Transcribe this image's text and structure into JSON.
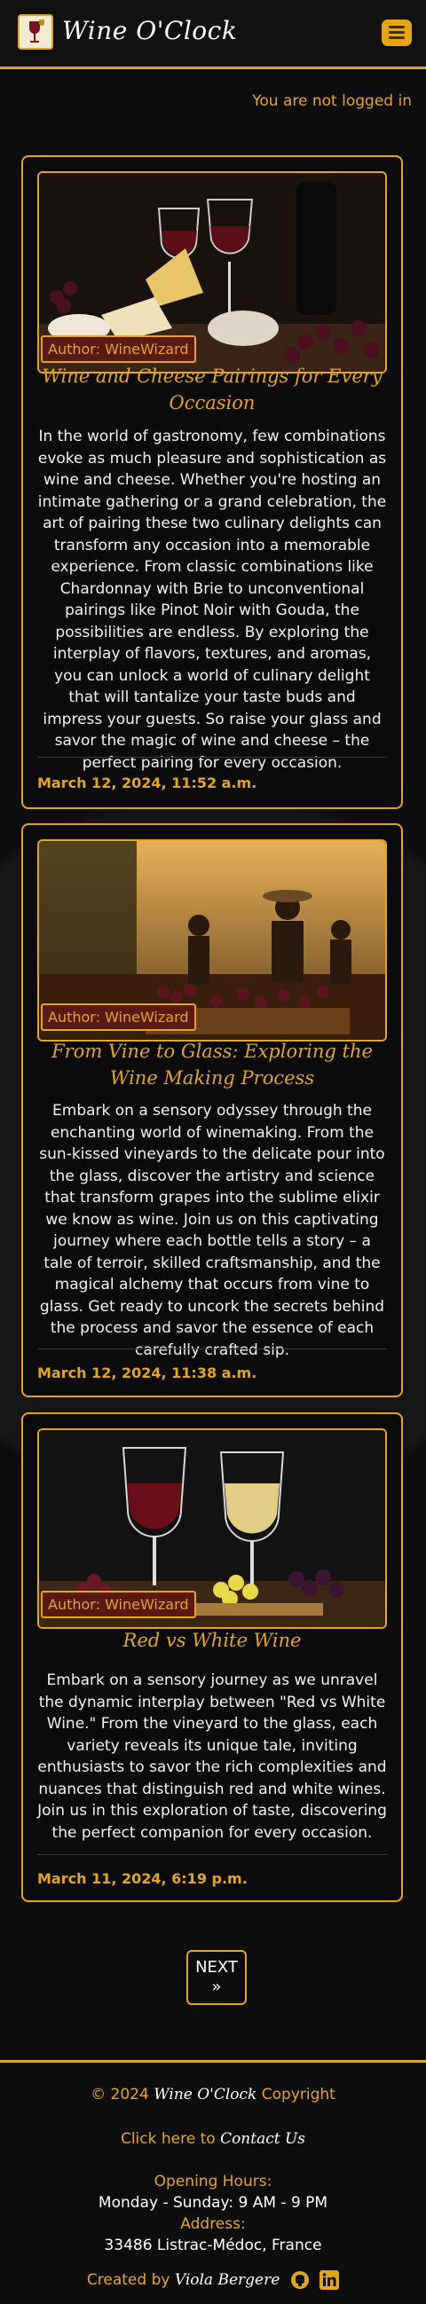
{
  "navbar": {
    "brand": "Wine O'Clock"
  },
  "auth": {
    "status": "You are not logged in"
  },
  "posts": [
    {
      "author": "Author: WineWizard",
      "title": "Wine and Cheese Pairings for Every Occasion",
      "body": "In the world of gastronomy, few combinations evoke as much pleasure and sophistication as wine and cheese. Whether you're hosting an intimate gathering or a grand celebration, the art of pairing these two culinary delights can transform any occasion into a memorable experience. From classic combinations like Chardonnay with Brie to unconventional pairings like Pinot Noir with Gouda, the possibilities are endless. By exploring the interplay of flavors, textures, and aromas, you can unlock a world of culinary delight that will tantalize your taste buds and impress your guests. So raise your glass and savor the magic of wine and cheese – the perfect pairing for every occasion.",
      "date": "March 12, 2024, 11:52 a.m."
    },
    {
      "author": "Author: WineWizard",
      "title": "From Vine to Glass: Exploring the Wine Making Process",
      "body": "Embark on a sensory odyssey through the enchanting world of winemaking. From the sun-kissed vineyards to the delicate pour into the glass, discover the artistry and science that transform grapes into the sublime elixir we know as wine. Join us on this captivating journey where each bottle tells a story – a tale of terroir, skilled craftsmanship, and the magical alchemy that occurs from vine to glass. Get ready to uncork the secrets behind the process and savor the essence of each carefully crafted sip.",
      "date": "March 12, 2024, 11:38 a.m."
    },
    {
      "author": "Author: WineWizard",
      "title": "Red vs White Wine",
      "body": "Embark on a sensory journey as we unravel the dynamic interplay between \"Red vs White Wine.\" From the vineyard to the glass, each variety reveals its unique tale, inviting enthusiasts to savor the rich complexities and nuances that distinguish red and white wines. Join us in this exploration of taste, discovering the perfect companion for every occasion.",
      "date": "March 11, 2024, 6:19 p.m."
    }
  ],
  "pagination": {
    "next_label": "NEXT",
    "next_arrow": "»"
  },
  "footer": {
    "copyright_prefix": "© 2024",
    "copyright_brand": "Wine O'Clock",
    "copyright_suffix": "Copyright",
    "contact_prefix": "Click here to",
    "contact_link": "Contact Us",
    "hours_label": "Opening Hours:",
    "hours_value": "Monday - Sunday: 9 AM - 9 PM",
    "address_label": "Address:",
    "address_value": "33486 Listrac-Médoc, France",
    "created_prefix": "Created by",
    "created_name": "Viola Bergere"
  },
  "colors": {
    "accent": "#e3a617",
    "background": "#0d0d0d",
    "badge": "#5a1a14"
  },
  "icons": [
    "hamburger-menu-icon",
    "github-icon",
    "linkedin-icon"
  ]
}
